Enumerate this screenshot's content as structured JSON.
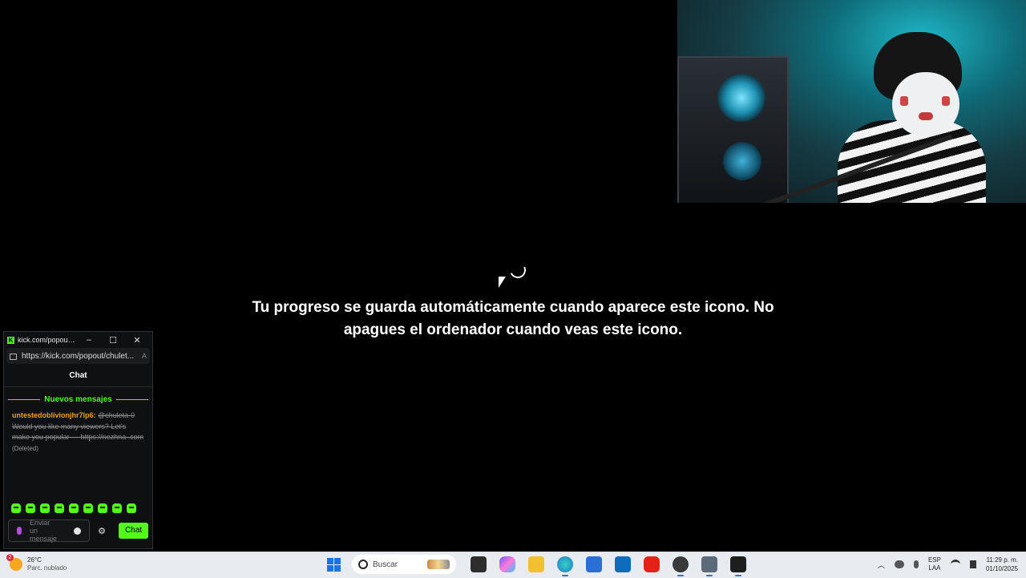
{
  "game": {
    "save_message": "Tu progreso se guarda automáticamente cuando aparece este icono. No apagues el ordenador cuando veas este icono."
  },
  "chat_window": {
    "title": "kick.com/popout/ch...",
    "url": "https://kick.com/popout/chulet...",
    "header": "Chat",
    "new_messages_label": "Nuevos mensajes",
    "message": {
      "username": "untestedoblivionjhr7lp6:",
      "mention": "@chuleta-0",
      "text": "Would you like many viewers? Let's make you popular — https://nezhna .com",
      "deleted_label": "(Deleted)"
    },
    "input_placeholder": "Enviar un mensaje",
    "send_label": "Chat",
    "accent_color": "#53fc18"
  },
  "taskbar": {
    "weather": {
      "badge": "2",
      "temp": "26°C",
      "desc": "Parc. nublado"
    },
    "search_placeholder": "Buscar",
    "apps": [
      "task-view",
      "copilot",
      "file-explorer",
      "edge",
      "microsoft-store",
      "outlook",
      "youtube",
      "obs",
      "camera",
      "terminal"
    ],
    "language": {
      "line1": "ESP",
      "line2": "LAA"
    },
    "clock": {
      "time": "11:29 p. m.",
      "date": "01/10/2025"
    }
  }
}
